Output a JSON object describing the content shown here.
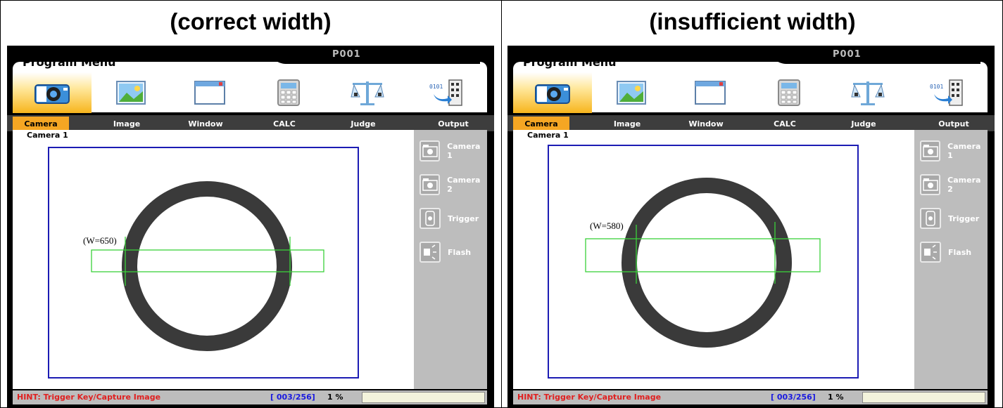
{
  "captions": {
    "left": "(correct width)",
    "right": "(insufficient width)"
  },
  "screens": [
    {
      "title": "Program Menu",
      "program_no": "P001",
      "tabs": [
        "Camera",
        "Image",
        "Window",
        "CALC",
        "Judge",
        "Output"
      ],
      "active_tab": "Camera",
      "camera_title": "Camera 1",
      "side_items": [
        "Camera 1",
        "Camera 2",
        "Trigger",
        "Flash"
      ],
      "width_label": "(W=650)",
      "hint": "HINT: Trigger Key/Capture Image",
      "counter": "[ 003/256]",
      "percent": "1 %"
    },
    {
      "title": "Program Menu",
      "program_no": "P001",
      "tabs": [
        "Camera",
        "Image",
        "Window",
        "CALC",
        "Judge",
        "Output"
      ],
      "active_tab": "Camera",
      "camera_title": "Camera 1",
      "side_items": [
        "Camera 1",
        "Camera 2",
        "Trigger",
        "Flash"
      ],
      "width_label": "(W=580)",
      "hint": "HINT: Trigger Key/Capture Image",
      "counter": "[ 003/256]",
      "percent": "1 %"
    }
  ],
  "colors": {
    "active_tab": "#f5a623",
    "hint_text": "#e02020",
    "counter_text": "#1a1ae0",
    "frame_border": "#1c1cb4",
    "measure_box": "#3ad13a"
  }
}
